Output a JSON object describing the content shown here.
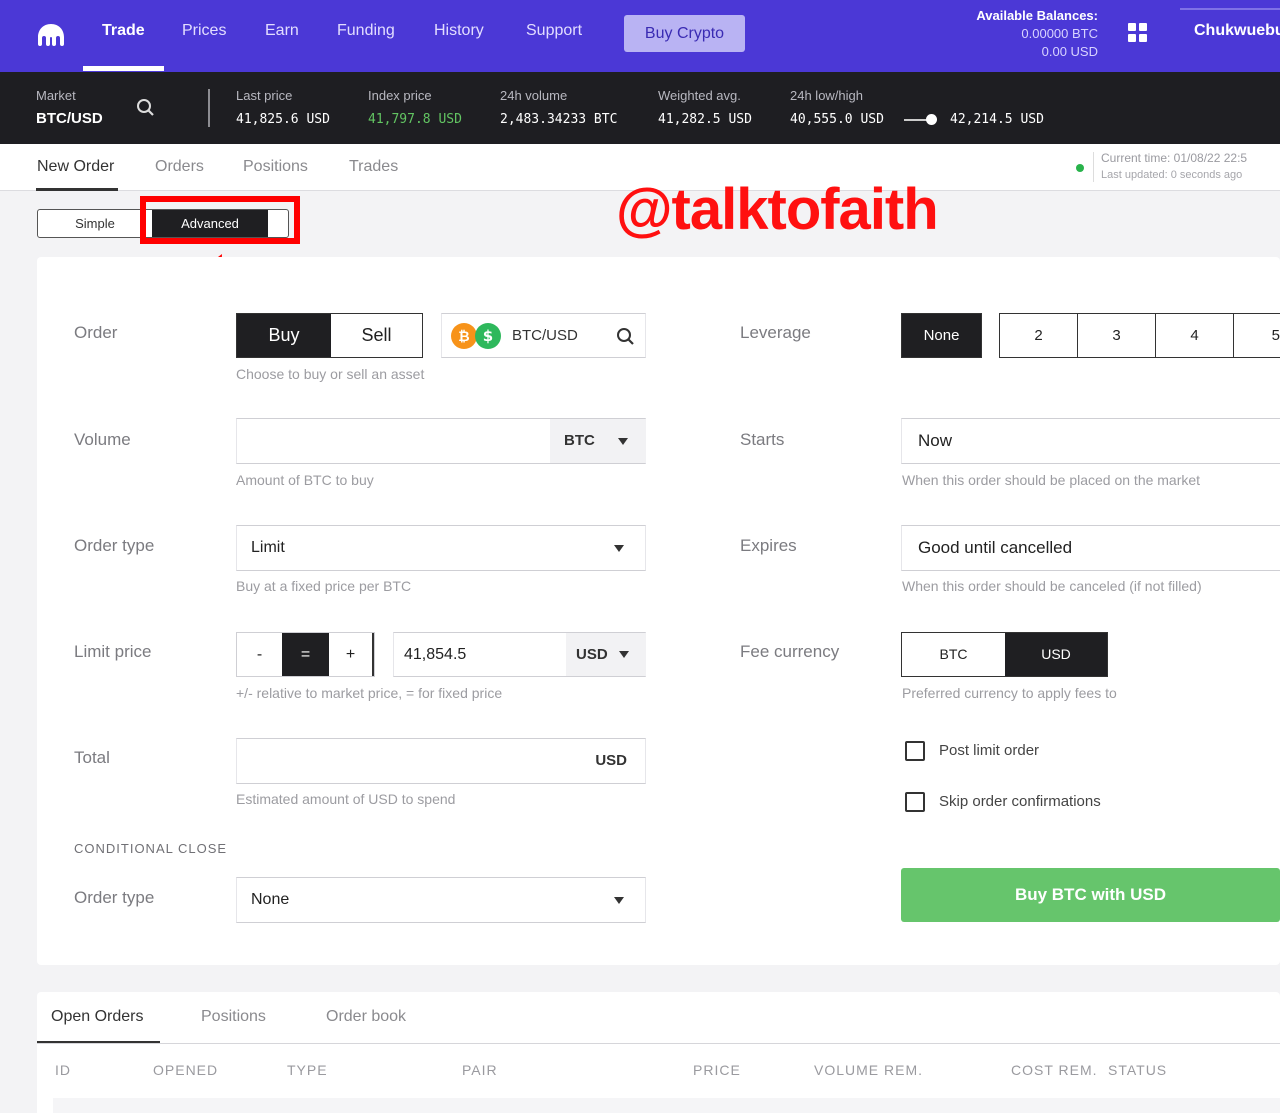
{
  "nav": {
    "items": [
      "Trade",
      "Prices",
      "Earn",
      "Funding",
      "History",
      "Support"
    ],
    "buy_crypto": "Buy Crypto",
    "balances_label": "Available Balances:",
    "balance_btc": "0.00000 BTC",
    "balance_usd": "0.00 USD",
    "user": "Chukwuebu"
  },
  "ticker": {
    "market_label": "Market",
    "market": "BTC/USD",
    "last_price_label": "Last price",
    "last_price": "41,825.6 USD",
    "index_price_label": "Index price",
    "index_price": "41,797.8 USD",
    "volume_label": "24h volume",
    "volume": "2,483.34233 BTC",
    "weighted_label": "Weighted avg.",
    "weighted": "41,282.5 USD",
    "lowhigh_label": "24h low/high",
    "low": "40,555.0 USD",
    "high": "42,214.5 USD"
  },
  "tabs": [
    "New Order",
    "Orders",
    "Positions",
    "Trades"
  ],
  "status": {
    "current_time": "Current time: 01/08/22 22:5",
    "last_updated": "Last updated: 0 seconds ago"
  },
  "mode": {
    "simple": "Simple",
    "advanced": "Advanced"
  },
  "watermark": "@talktofaith",
  "form": {
    "order_label": "Order",
    "buy": "Buy",
    "sell": "Sell",
    "pair": "BTC/USD",
    "order_hint": "Choose to buy or sell an asset",
    "volume_label": "Volume",
    "volume_unit": "BTC",
    "volume_hint": "Amount of BTC to buy",
    "order_type_label": "Order type",
    "order_type": "Limit",
    "order_type_hint": "Buy at a fixed price per BTC",
    "limit_price_label": "Limit price",
    "minus": "-",
    "equals": "=",
    "plus": "+",
    "limit_price": "41,854.5",
    "limit_unit": "USD",
    "limit_hint": "+/- relative to market price, = for fixed price",
    "total_label": "Total",
    "total_unit": "USD",
    "total_hint": "Estimated amount of USD to spend",
    "conditional_close": "CONDITIONAL CLOSE",
    "close_type_label": "Order type",
    "close_type": "None",
    "leverage_label": "Leverage",
    "leverage_options": [
      "None",
      "2",
      "3",
      "4",
      "5"
    ],
    "starts_label": "Starts",
    "starts": "Now",
    "starts_hint": "When this order should be placed on the market",
    "expires_label": "Expires",
    "expires": "Good until cancelled",
    "expires_hint": "When this order should be canceled (if not filled)",
    "fee_label": "Fee currency",
    "fee_btc": "BTC",
    "fee_usd": "USD",
    "fee_hint": "Preferred currency to apply fees to",
    "post_limit": "Post limit order",
    "skip_confirm": "Skip order confirmations",
    "submit": "Buy BTC with USD"
  },
  "bottom": {
    "tabs": [
      "Open Orders",
      "Positions",
      "Order book"
    ],
    "columns": [
      "ID",
      "OPENED",
      "TYPE",
      "PAIR",
      "PRICE",
      "VOLUME REM.",
      "COST REM.",
      "STATUS"
    ]
  },
  "colors": {
    "nav_bg": "#4b38d6",
    "ticker_bg": "#1e1e22",
    "accent_green": "#66c56c",
    "highlight_red": "#ff0000"
  }
}
